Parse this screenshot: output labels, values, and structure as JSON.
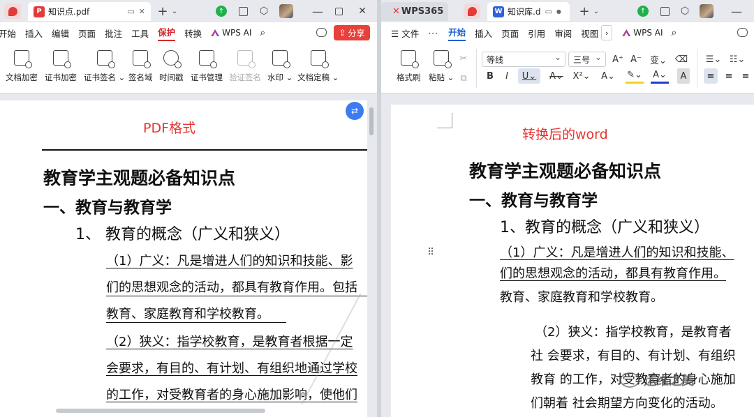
{
  "left_window": {
    "tab_title": "知识点.pdf",
    "menu": [
      "开始",
      "插入",
      "编辑",
      "页面",
      "批注",
      "工具",
      "保护",
      "转换"
    ],
    "active_menu": "保护",
    "wps_ai": "WPS AI",
    "share_label": "分享",
    "ribbon": [
      {
        "label": "文档加密",
        "icon": "document-lock-icon",
        "enabled": true
      },
      {
        "label": "证书加密",
        "icon": "certificate-lock-icon",
        "enabled": true
      },
      {
        "label": "证书签名",
        "icon": "certificate-sign-icon",
        "enabled": true,
        "dropdown": true
      },
      {
        "label": "签名域",
        "icon": "signature-field-icon",
        "enabled": true
      },
      {
        "label": "时间戳",
        "icon": "clock-icon",
        "enabled": true
      },
      {
        "label": "证书管理",
        "icon": "certificate-manage-icon",
        "enabled": true
      },
      {
        "label": "验证签名",
        "icon": "pen-icon",
        "enabled": false
      },
      {
        "label": "水印",
        "icon": "watermark-icon",
        "enabled": true,
        "dropdown": true
      },
      {
        "label": "文档定稿",
        "icon": "finalize-doc-icon",
        "enabled": true,
        "dropdown": true
      }
    ],
    "annotation": "PDF格式",
    "content": {
      "h1": "教育学主观题必备知识点",
      "h2": "一、教育与教育学",
      "h3": "1、  教育的概念（广义和狭义）",
      "p1": "（1）广义：凡是增进人们的知识和技能、影",
      "p2": "们的思想观念的活动，都具有教育作用。包括",
      "p3": "教育、家庭教育和学校教育。",
      "p4": "（2）狭义：指学校教育，是教育者根据一定",
      "p5": "会要求，有目的、有计划、有组织地通过学校",
      "p6": "的工作，对受教育者的身心施加影响，使他们"
    }
  },
  "right_window": {
    "wps365_label": "WPS365",
    "tab_title": "知识库.d",
    "menu_file": "文件",
    "menu": [
      "开始",
      "插入",
      "页面",
      "引用",
      "审阅",
      "视图"
    ],
    "active_menu": "开始",
    "wps_ai": "WPS AI",
    "format_painter": "格式刷",
    "paste": "粘贴",
    "font_name": "等线",
    "font_size": "三号",
    "annotation": "转换后的word",
    "content": {
      "h1": "教育学主观题必备知识点",
      "h2": "一、教育与教育学",
      "h3": "1、教育的概念（广义和狭义）",
      "p1": "（1）广义：凡是增进人们的知识和技能、",
      "p2": "们的思想观念的活动，都具有教育作用。",
      "p3": "教育、家庭教育和学校教育。",
      "p4": "（2）狭义：指学校教育，是教育者",
      "p5": "社 会要求，有目的、有计划、有组织",
      "p6": "教育 的工作，对受教育者的身心施加",
      "p7": "们朝着 社会期望方向变化的活动。"
    },
    "watermark": "运维之美"
  }
}
